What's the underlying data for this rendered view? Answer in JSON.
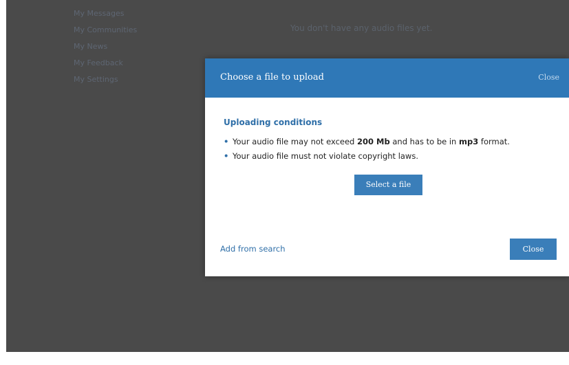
{
  "background": {
    "side_menu": [
      {
        "label": "My Messages"
      },
      {
        "label": "My Communities"
      },
      {
        "label": "My News"
      },
      {
        "label": "My Feedback"
      },
      {
        "label": "My Settings"
      }
    ],
    "empty_text": "You don't have any audio files yet."
  },
  "modal": {
    "title": "Choose a file to upload",
    "header_close": "Close",
    "conditions_title": "Uploading conditions",
    "conditions": [
      {
        "before": "Your audio file may not exceed ",
        "bold": "200 Mb",
        "after": " and has to be in ",
        "bold2": "mp3",
        "after2": " format."
      },
      {
        "before": "Your audio file must not violate copyright laws.",
        "bold": "",
        "after": "",
        "bold2": "",
        "after2": ""
      }
    ],
    "select_button": "Select a file",
    "add_from_search": "Add from search",
    "close_button": "Close"
  },
  "colors": {
    "overlay": "#4a4a4a",
    "header": "#2f78b7",
    "button": "#3a7eb9",
    "link": "#2f6fa8"
  }
}
